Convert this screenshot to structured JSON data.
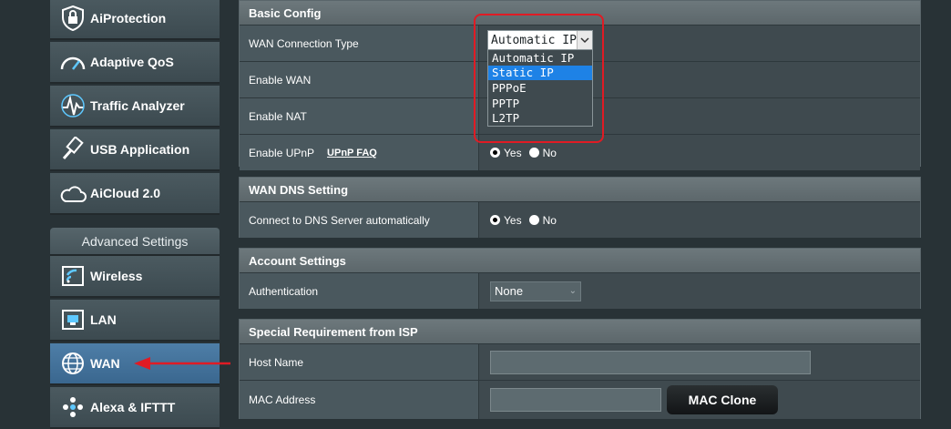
{
  "sidebar": {
    "items": [
      {
        "label": "AiProtection",
        "icon": "lock-shield-icon"
      },
      {
        "label": "Adaptive QoS",
        "icon": "speedometer-icon"
      },
      {
        "label": "Traffic Analyzer",
        "icon": "traffic-analyzer-icon"
      },
      {
        "label": "USB Application",
        "icon": "usb-icon"
      },
      {
        "label": "AiCloud 2.0",
        "icon": "cloud-icon"
      }
    ],
    "advanced_header": "Advanced Settings",
    "advanced_items": [
      {
        "label": "Wireless",
        "icon": "wifi-icon"
      },
      {
        "label": "LAN",
        "icon": "lan-icon"
      },
      {
        "label": "WAN",
        "icon": "globe-icon"
      },
      {
        "label": "Alexa & IFTTT",
        "icon": "alexa-icon"
      }
    ]
  },
  "basic_config": {
    "title": "Basic Config",
    "wan_type_label": "WAN Connection Type",
    "enable_wan_label": "Enable WAN",
    "enable_nat_label": "Enable NAT",
    "enable_upnp_label": "Enable UPnP",
    "upnp_faq": "UPnP FAQ",
    "yes": "Yes",
    "no": "No"
  },
  "wan_dropdown": {
    "current": "Automatic IP",
    "options": [
      "Automatic IP",
      "Static IP",
      "PPPoE",
      "PPTP",
      "L2TP"
    ],
    "highlighted": "Static IP"
  },
  "dns": {
    "title": "WAN DNS Setting",
    "connect_label": "Connect to DNS Server automatically",
    "yes": "Yes",
    "no": "No"
  },
  "account": {
    "title": "Account Settings",
    "auth_label": "Authentication",
    "auth_value": "None"
  },
  "isp": {
    "title": "Special Requirement from ISP",
    "host_label": "Host Name",
    "mac_label": "MAC Address",
    "mac_clone": "MAC Clone"
  },
  "colors": {
    "highlight": "#e01b24",
    "selected_option": "#1e82e6",
    "active_nav": "#4e7ea7"
  }
}
